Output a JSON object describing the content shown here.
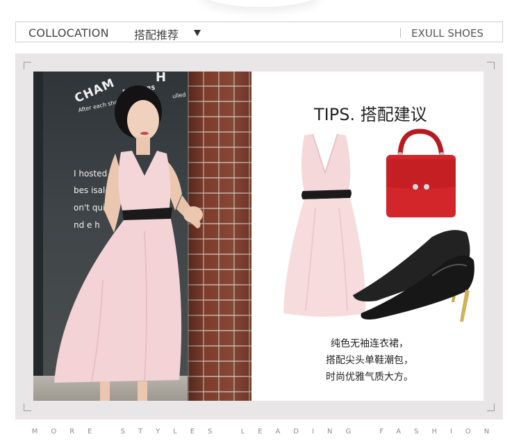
{
  "header": {
    "title_en": "COLLOCATION",
    "title_cn": "搭配推荐",
    "brand": "EXULL SHOES"
  },
  "photo": {
    "sign_top": "CHAM",
    "sign_roasters": "ROASTERS",
    "sign_after": "After each shot of",
    "sign_pulled": "ulled",
    "sign_h": "H",
    "glass_lines": [
      "I hosted e",
      "bes isald",
      "on't quit",
      "nd e h"
    ]
  },
  "tips": {
    "title": "TIPS. 搭配建议",
    "description": [
      "纯色无袖连衣裙，",
      "搭配尖头单鞋潮包，",
      "时尚优雅气质大方。"
    ]
  },
  "footer": {
    "tagline": "MORE STYLES LEADING FASHION"
  },
  "colors": {
    "panel_bg": "#e8e6e7",
    "dress_pink": "#f4d6d8",
    "bag_red": "#d3262b",
    "shoe_black": "#1c1c1c",
    "belt_black": "#1a1a1a"
  },
  "icons": {
    "dropdown": "triangle-down-icon"
  }
}
